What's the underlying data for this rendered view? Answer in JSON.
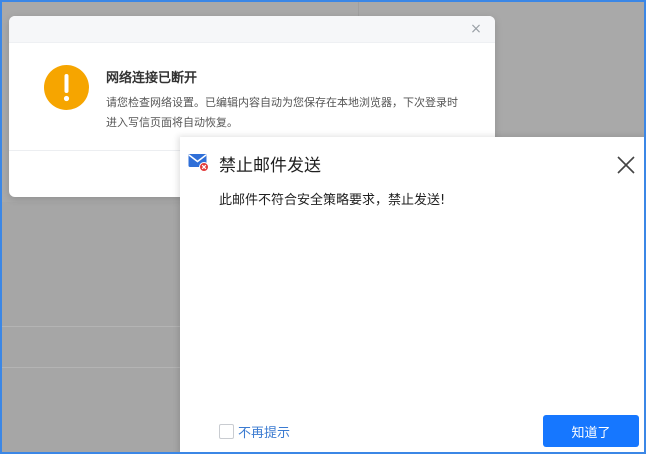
{
  "network_dialog": {
    "title": "网络连接已断开",
    "message": "请您检查网络设置。已编辑内容自动为您保存在本地浏览器，下次登录时进入写信页面将自动恢复。",
    "close_glyph": "×"
  },
  "block_dialog": {
    "title": "禁止邮件发送",
    "message": "此邮件不符合安全策略要求，禁止发送!",
    "dont_remind_label": "不再提示",
    "ok_label": "知道了"
  },
  "colors": {
    "accent": "#1677ff",
    "warning": "#f6a500",
    "frame_border": "#3b87e6",
    "overlay": "#a9a9a9"
  },
  "icons": {
    "warning": "warning-icon",
    "mail_blocked": "mail-blocked-icon",
    "close": "close-icon"
  }
}
